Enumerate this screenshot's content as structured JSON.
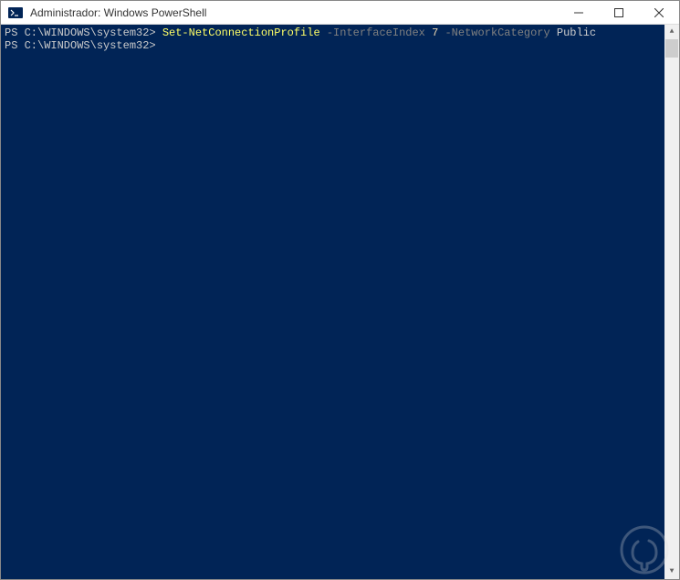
{
  "window": {
    "title": "Administrador: Windows PowerShell"
  },
  "terminal": {
    "lines": [
      {
        "prompt": "PS C:\\WINDOWS\\system32> ",
        "cmdlet": "Set-NetConnectionProfile",
        "segments": [
          {
            "text": " -InterfaceIndex ",
            "cls": "param"
          },
          {
            "text": "7",
            "cls": "value-num"
          },
          {
            "text": " -NetworkCategory ",
            "cls": "param"
          },
          {
            "text": "Public",
            "cls": "value-str"
          }
        ]
      },
      {
        "prompt": "PS C:\\WINDOWS\\system32> ",
        "cmdlet": "",
        "segments": []
      }
    ]
  }
}
